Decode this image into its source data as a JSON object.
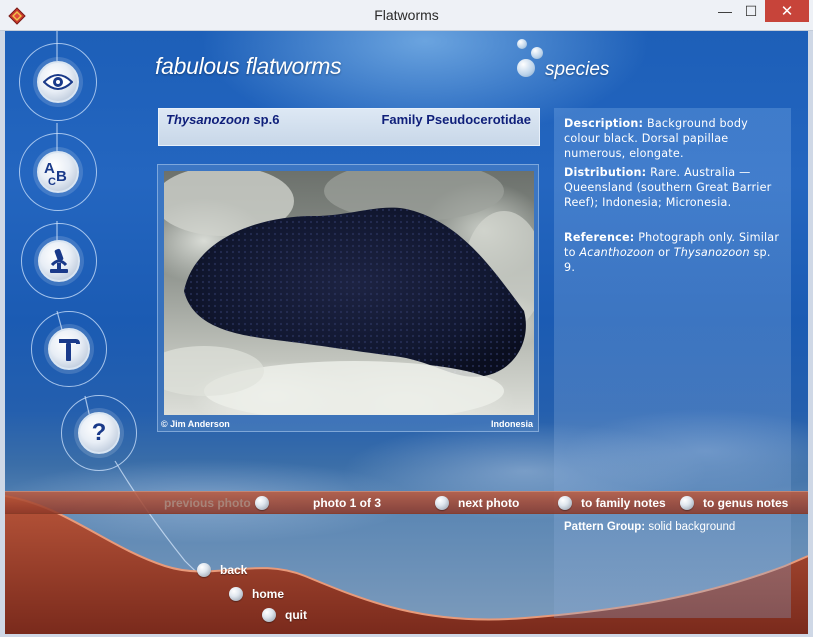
{
  "window": {
    "title": "Flatworms",
    "minimize": "—",
    "maximize": "☐",
    "close": "✕"
  },
  "brand": {
    "title": "fabulous flatworms",
    "section": "species"
  },
  "nav_icons": [
    {
      "name": "eye-icon"
    },
    {
      "name": "abc-icon"
    },
    {
      "name": "microscope-icon"
    },
    {
      "name": "hammer-icon"
    },
    {
      "name": "help-icon",
      "glyph": "?"
    }
  ],
  "species": {
    "genus": "Thysanozoon",
    "epithet": "sp.6",
    "family": "Family Pseudocerotidae"
  },
  "photo": {
    "credit": "© Jim Anderson",
    "location": "Indonesia"
  },
  "description": {
    "description_label": "Description:",
    "description_text": "Background body colour black. Dorsal papillae numerous, elongate.",
    "distribution_label": "Distribution:",
    "distribution_text": "Rare. Australia — Queensland (southern Great Barrier Reef); Indonesia; Micronesia.",
    "reference_label": "Reference:",
    "reference_text_1": "Photograph only. Similar to",
    "reference_genus_1": "Acanthozoon",
    "reference_or": "or",
    "reference_genus_2": "Thysanozoon",
    "reference_text_2": "sp. 9."
  },
  "photo_nav": {
    "previous": "previous photo",
    "counter": "photo 1 of 3",
    "next": "next photo",
    "family_notes": "to family notes",
    "genus_notes": "to genus notes"
  },
  "pattern": {
    "label": "Pattern Group:",
    "value": "solid background"
  },
  "footer": {
    "back": "back",
    "home": "home",
    "quit": "quit"
  },
  "colors": {
    "accent_dark_blue": "#0f1f7a",
    "bg_blue": "#1d5fb8",
    "nav_bar": "#b45a3c"
  }
}
